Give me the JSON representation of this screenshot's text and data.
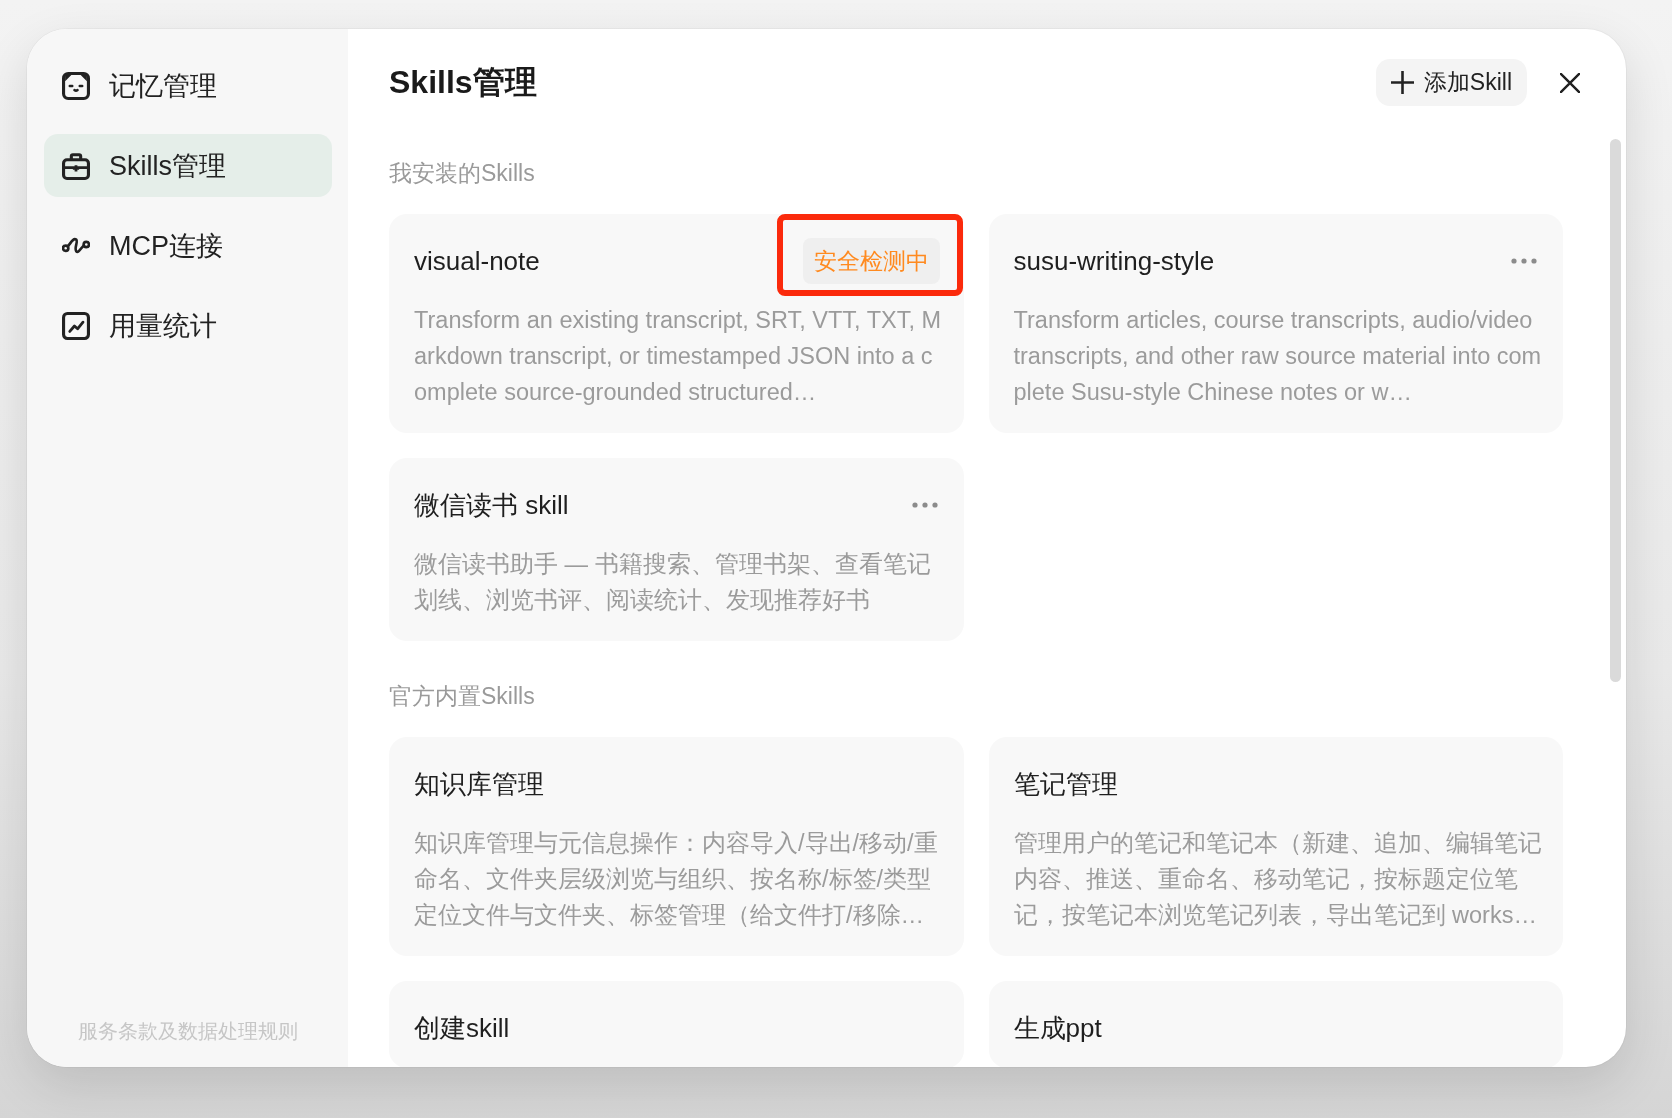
{
  "sidebar": {
    "items": [
      {
        "label": "记忆管理",
        "selected": false
      },
      {
        "label": "Skills管理",
        "selected": true
      },
      {
        "label": "MCP连接",
        "selected": false
      },
      {
        "label": "用量统计",
        "selected": false
      }
    ],
    "footer_link": "服务条款及数据处理规则"
  },
  "header": {
    "title": "Skills管理",
    "add_button": "添加Skill"
  },
  "sections": [
    {
      "label": "我安装的Skills",
      "cards": [
        {
          "title": "visual-note",
          "description": "Transform an existing transcript, SRT, VTT, TXT, Markdown transcript, or timestamped JSON into a complete source-grounded structured…",
          "badge": {
            "text": "安全检测中",
            "highlighted": true
          },
          "more_button": false
        },
        {
          "title": "susu-writing-style",
          "description": "Transform articles, course transcripts, audio/video transcripts, and other raw source material into complete Susu-style Chinese notes or w…",
          "more_button": true
        },
        {
          "title": "微信读书 skill",
          "description": "微信读书助手 — 书籍搜索、管理书架、查看笔记划线、浏览书评、阅读统计、发现推荐好书",
          "more_button": true
        }
      ]
    },
    {
      "label": "官方内置Skills",
      "cards": [
        {
          "title": "知识库管理",
          "description": "知识库管理与元信息操作：内容导入/导出/移动/重命名、文件夹层级浏览与组织、按名称/标签/类型定位文件与文件夹、标签管理（给文件打/移除…",
          "more_button": false
        },
        {
          "title": "笔记管理",
          "description": "管理用户的笔记和笔记本（新建、追加、编辑笔记内容、推送、重命名、移动笔记，按标题定位笔记，按笔记本浏览笔记列表，导出笔记到 works…",
          "more_button": false
        },
        {
          "title": "创建skill",
          "more_button": false
        },
        {
          "title": "生成ppt",
          "more_button": false
        }
      ]
    }
  ]
}
